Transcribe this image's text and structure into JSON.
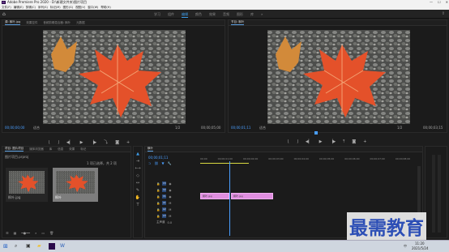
{
  "window": {
    "title": "Adobe Premiere Pro 2020 - D:\\新建文件夹\\图片项目",
    "min": "—",
    "max": "☐",
    "close": "✕"
  },
  "menu": [
    "文件(F)",
    "编辑(E)",
    "剪辑(C)",
    "序列(S)",
    "标记(M)",
    "图形(G)",
    "视图(V)",
    "窗口(W)",
    "帮助(H)"
  ],
  "workspace": {
    "tabs": [
      "学习",
      "组件",
      "编辑",
      "颜色",
      "效果",
      "音频",
      "图形",
      "库"
    ],
    "active_index": 2,
    "more": "»"
  },
  "source_panel": {
    "tabs": [
      "源: 枫叶.jpg",
      "效果控件",
      "音频剪辑混合器: 枫叶",
      "元数据"
    ],
    "timecode_left": "00;00;00;00",
    "fit": "适合",
    "ratio": "1/2",
    "timecode_right": "00;00;05;00"
  },
  "program_panel": {
    "tabs": [
      "节目: 枫叶"
    ],
    "timecode_left": "00;00;01;11",
    "fit": "适合",
    "ratio": "1/2",
    "timecode_right": "00;00;03;15"
  },
  "project_panel": {
    "tabs": [
      "项目: 图片项目",
      "媒体浏览器",
      "库",
      "信息",
      "效果",
      "标记"
    ],
    "file": "图片项目.prproj",
    "selection": "1 项已选择，共 2 项",
    "items": [
      {
        "label": "枫叶.jpg"
      },
      {
        "label": "枫叶"
      }
    ]
  },
  "timeline": {
    "tab": "枫叶",
    "timecode": "00;00;01;11",
    "ruler": [
      "00;00",
      "00;00;01;00",
      "00;00;02;00",
      "00;00;03;00",
      "00;00;04;00",
      "00;00;05;00",
      "00;00;06;00",
      "00;00;07;00",
      "00;00;08;00"
    ],
    "video_tracks": [
      "V3",
      "V2",
      "V1"
    ],
    "audio_tracks": [
      "A1",
      "A2",
      "A3"
    ],
    "master": "主声道",
    "master_value": "0.0",
    "clips": [
      {
        "label": "枫叶.jpg"
      },
      {
        "label": "枫叶.jpg"
      }
    ]
  },
  "taskbar": {
    "time": "11:20",
    "date": "2021/5/24",
    "lang": "中"
  },
  "watermark": "最需教育",
  "colors": {
    "accent": "#3d9ce8",
    "clip": "#e08ee0",
    "timecode": "#4a9eff"
  }
}
